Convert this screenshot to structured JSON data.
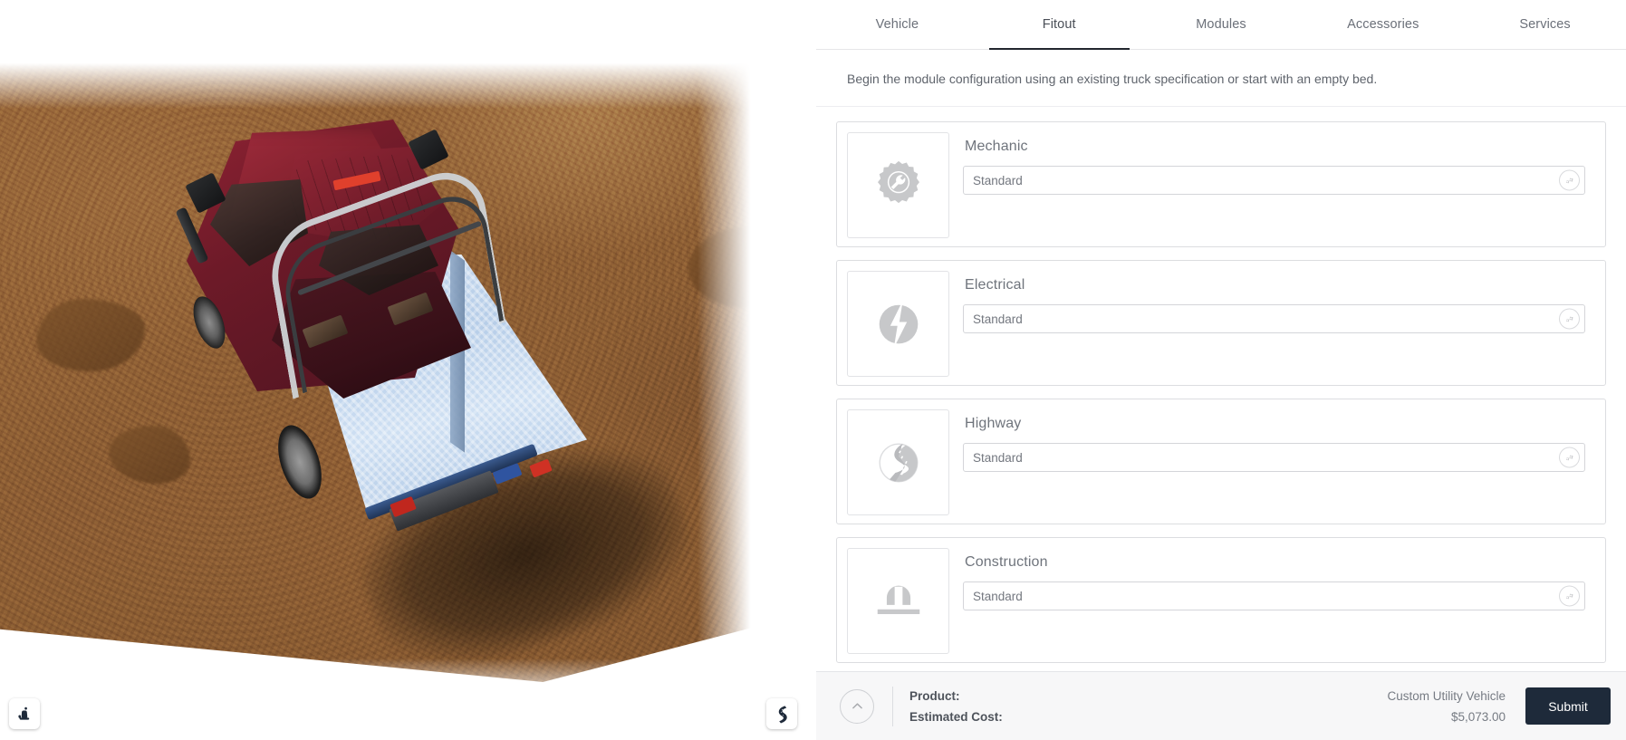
{
  "tabs": [
    {
      "id": "vehicle",
      "label": "Vehicle",
      "active": false
    },
    {
      "id": "fitout",
      "label": "Fitout",
      "active": true
    },
    {
      "id": "modules",
      "label": "Modules",
      "active": false
    },
    {
      "id": "accessories",
      "label": "Accessories",
      "active": false
    },
    {
      "id": "services",
      "label": "Services",
      "active": false
    }
  ],
  "intro": {
    "text": "Begin the module configuration using an existing truck specification or start with an empty bed."
  },
  "cards": [
    {
      "id": "mechanic",
      "title": "Mechanic",
      "icon": "gear-wrench-icon",
      "spec_value": "Standard",
      "gear_button": "settings-gear-icon"
    },
    {
      "id": "electrical",
      "title": "Electrical",
      "icon": "lightning-bolt-icon",
      "spec_value": "Standard",
      "gear_button": "settings-gear-icon"
    },
    {
      "id": "highway",
      "title": "Highway",
      "icon": "winding-road-icon",
      "spec_value": "Standard",
      "gear_button": "settings-gear-icon"
    },
    {
      "id": "construction",
      "title": "Construction",
      "icon": "hard-hat-icon",
      "spec_value": "Standard",
      "gear_button": "settings-gear-icon"
    }
  ],
  "bottom_bar": {
    "collapse_icon": "chevron-up-icon",
    "product_label": "Product:",
    "product_value": "Custom Utility Vehicle",
    "cost_label": "Estimated Cost:",
    "cost_value": "$5,073.00",
    "submit_label": "Submit"
  },
  "viewport": {
    "seat_button_icon": "car-seat-icon",
    "road_button_icon": "winding-road-icon"
  },
  "colors": {
    "accent_dark": "#1e2a3a",
    "tab_active_underline": "#22262e",
    "panel_bg": "#ffffff",
    "bottom_bar_bg": "#f7f7f8",
    "icon_gray": "#c9cacc",
    "border": "#dcdde0"
  }
}
